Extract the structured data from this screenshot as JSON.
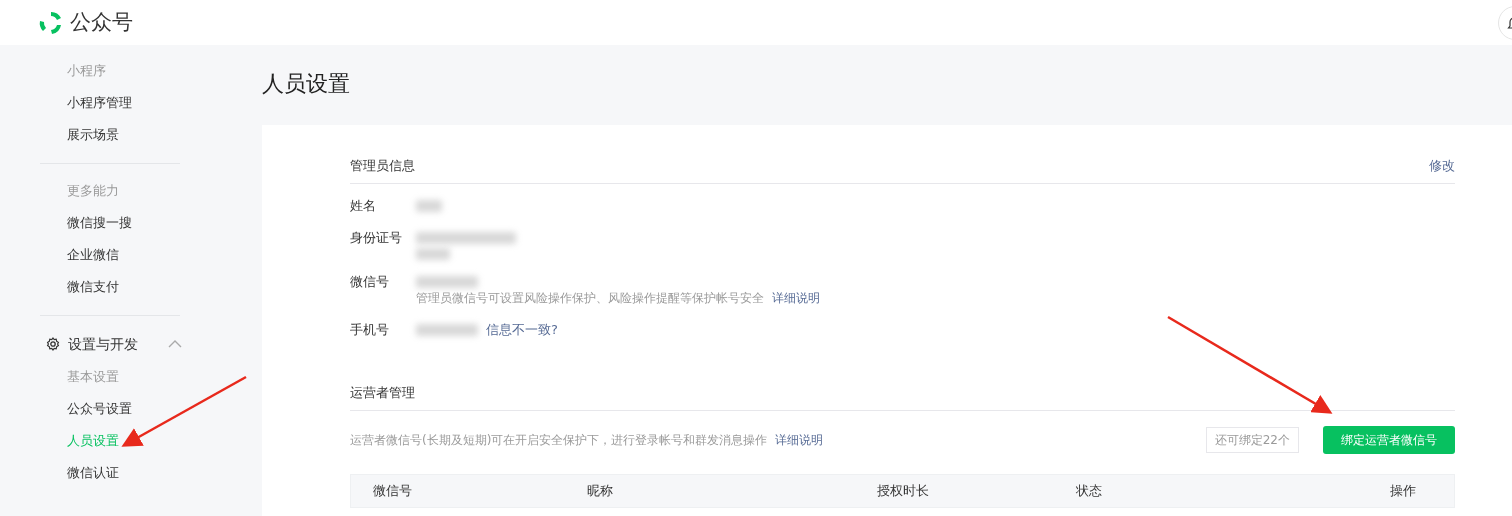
{
  "header": {
    "logo_text": "公众号"
  },
  "sidebar": [
    {
      "kind": "group",
      "title": "小程序",
      "items": [
        {
          "label": "小程序管理",
          "selected": false
        },
        {
          "label": "展示场景",
          "selected": false
        }
      ]
    },
    {
      "kind": "group",
      "title": "更多能力",
      "items": [
        {
          "label": "微信搜一搜",
          "selected": false
        },
        {
          "label": "企业微信",
          "selected": false
        },
        {
          "label": "微信支付",
          "selected": false
        }
      ]
    },
    {
      "kind": "category",
      "title": "设置与开发",
      "expanded": true,
      "children": [
        {
          "kind": "group",
          "title": "基本设置",
          "items": [
            {
              "label": "公众号设置",
              "selected": false
            },
            {
              "label": "人员设置",
              "selected": true
            },
            {
              "label": "微信认证",
              "selected": false
            }
          ]
        }
      ]
    }
  ],
  "page_title": "人员设置",
  "admin_section": {
    "title": "管理员信息",
    "edit_link": "修改",
    "fields": [
      {
        "label": "姓名",
        "kind": "short"
      },
      {
        "label": "身份证号",
        "kind": "double"
      },
      {
        "label": "微信号",
        "kind": "medium",
        "hint": "管理员微信号可设置风险操作保护、风险操作提醒等保护帐号安全",
        "link": "详细说明"
      },
      {
        "label": "手机号",
        "kind": "medium",
        "link": "信息不一致?"
      }
    ]
  },
  "operator_section": {
    "title": "运营者管理",
    "description": "运营者微信号(长期及短期)可在开启安全保护下，进行登录帐号和群发消息操作",
    "link": "详细说明",
    "quota": "还可绑定22个",
    "button": "绑定运营者微信号",
    "table": {
      "columns": [
        "微信号",
        "昵称",
        "授权时长",
        "状态",
        "操作"
      ]
    }
  }
}
